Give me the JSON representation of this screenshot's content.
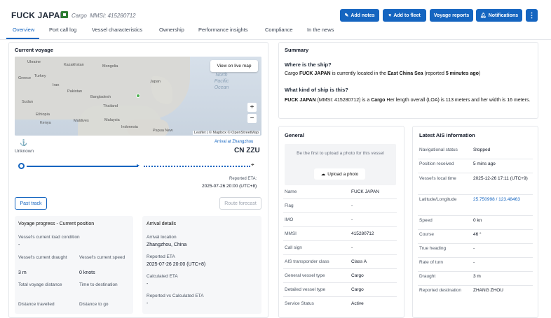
{
  "vessel": {
    "name": "FUCK JAPAN",
    "type": "Cargo",
    "mmsi_label": "MMSI: 415280712"
  },
  "actions": {
    "add_notes": "Add notes",
    "add_to_fleet": "Add to fleet",
    "voyage_reports": "Voyage reports",
    "notifications": "Notifications",
    "more": "⋮"
  },
  "tabs": [
    "Overview",
    "Port call log",
    "Vessel characteristics",
    "Ownership",
    "Performance insights",
    "Compliance",
    "In the news"
  ],
  "current_voyage": {
    "title": "Current voyage",
    "map": {
      "view_live": "View on live map",
      "labels": [
        "Ukraine",
        "Kazakhstan",
        "Mongolia",
        "Greece",
        "Turkey",
        "Iran",
        "Pakistan",
        "Bangladesh",
        "Thailand",
        "Sudan",
        "Ethiopia",
        "Kenya",
        "Maldives",
        "Malaysia",
        "Indonesia",
        "Papua New",
        "Japan"
      ],
      "ocean": "North\nPacific\nOcean",
      "zoom_in": "+",
      "zoom_out": "−",
      "attribution": "Leaflet | © Mapbox © OpenStreetMap"
    },
    "origin": "Unknown",
    "arrival_label": "Arrival at Zhangzhou",
    "dest_code": "CN ZZU",
    "eta_label": "Reported ETA:",
    "eta_value": "2025-07-26 20:00 (UTC+8)",
    "past_track": "Past track",
    "route_forecast": "Route forecast"
  },
  "voyage_progress": {
    "title": "Voyage progress - Current position",
    "load_label": "Vessel's current load condition",
    "load_value": "-",
    "draught_label": "Vessel's current draught",
    "draught_value": "3 m",
    "speed_label": "Vessel's current speed",
    "speed_value": "0 knots",
    "total_label": "Total voyage distance",
    "time_label": "Time to destination",
    "travelled_label": "Distance travelled",
    "togo_label": "Distance to go"
  },
  "arrival_details": {
    "title": "Arrival details",
    "location_label": "Arrival location",
    "location_value": "Zhangzhou, China",
    "eta_label": "Reported ETA",
    "eta_value": "2025-07-26 20:00 (UTC+8)",
    "calc_label": "Calculated ETA",
    "calc_value": "-",
    "vs_label": "Reported vs Calculated ETA",
    "vs_value": "-"
  },
  "summary": {
    "title": "Summary",
    "q1": "Where is the ship?",
    "a1_pre": "Cargo ",
    "a1_name": "FUCK JAPAN",
    "a1_mid": " is currently located in the ",
    "a1_loc": "East China Sea",
    "a1_post": " (reported ",
    "a1_time": "5 minutes ago",
    "a1_end": ")",
    "q2": "What kind of ship is this?",
    "a2_name": "FUCK JAPAN",
    "a2_mmsi": " (MMSI: 415280712) is a ",
    "a2_type": "Cargo",
    "a2_rest": " Her length overall (LOA) is 113 meters and her width is 16 meters."
  },
  "general": {
    "title": "General",
    "upload_text": "Be the first to upload a photo for this vessel",
    "upload_btn": "Upload a photo",
    "rows": [
      {
        "label": "Name",
        "value": "FUCK JAPAN"
      },
      {
        "label": "Flag",
        "value": "-"
      },
      {
        "label": "IMO",
        "value": "-"
      },
      {
        "label": "MMSI",
        "value": "415280712"
      },
      {
        "label": "Call sign",
        "value": "-"
      },
      {
        "label": "AIS transponder class",
        "value": "Class A"
      },
      {
        "label": "General vessel type",
        "value": "Cargo"
      },
      {
        "label": "Detailed vessel type",
        "value": "Cargo"
      },
      {
        "label": "Service Status",
        "value": "Active"
      }
    ]
  },
  "ais": {
    "title": "Latest AIS information",
    "rows": [
      {
        "label": "Navigational status",
        "value": "Stopped"
      },
      {
        "label": "Position received",
        "value": "5 mins ago"
      },
      {
        "label": "Vessel's local time",
        "value": "2025-12-26 17:11 (UTC+9)"
      },
      {
        "label": "Latitude/Longitude",
        "value": "25.750998 / 123.48463"
      },
      {
        "label": "Speed",
        "value": "0 kn"
      },
      {
        "label": "Course",
        "value": "46 °"
      },
      {
        "label": "True heading",
        "value": "-"
      },
      {
        "label": "Rate of turn",
        "value": "-"
      },
      {
        "label": "Draught",
        "value": "3 m"
      },
      {
        "label": "Reported destination",
        "value": "ZHANG ZHOU"
      }
    ]
  },
  "colors": {
    "accent": "#1565c0",
    "flag": "#2e7d32",
    "link": "#1565c0"
  }
}
